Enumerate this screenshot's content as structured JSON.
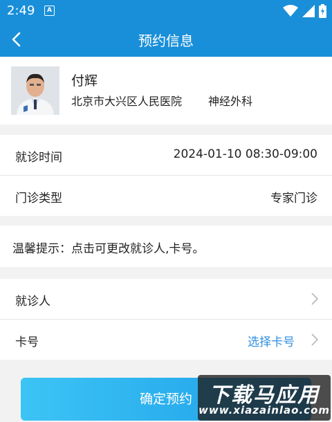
{
  "status": {
    "time": "2:49",
    "notif_icon": "A"
  },
  "nav": {
    "title": "预约信息",
    "back_icon": "chevron-left-icon"
  },
  "doctor": {
    "name": "付辉",
    "hospital": "北京市大兴区人民医院",
    "department": "神经外科"
  },
  "appointment": {
    "time_label": "就诊时间",
    "time_value": "2024-01-10 08:30-09:00",
    "type_label": "门诊类型",
    "type_value": "专家门诊"
  },
  "tip": {
    "text": "温馨提示：点击可更改就诊人,卡号。"
  },
  "patient": {
    "label": "就诊人",
    "value": ""
  },
  "card": {
    "label": "卡号",
    "value": "选择卡号"
  },
  "confirm": {
    "label": "确定预约"
  },
  "watermark": {
    "text_cn": "下载马应用",
    "text_url": "www.xiazainlao.com"
  },
  "colors": {
    "primary": "#1a8fd9",
    "link": "#2f8fdd",
    "button_start": "#3cc4f5",
    "button_end": "#1e9de8"
  }
}
